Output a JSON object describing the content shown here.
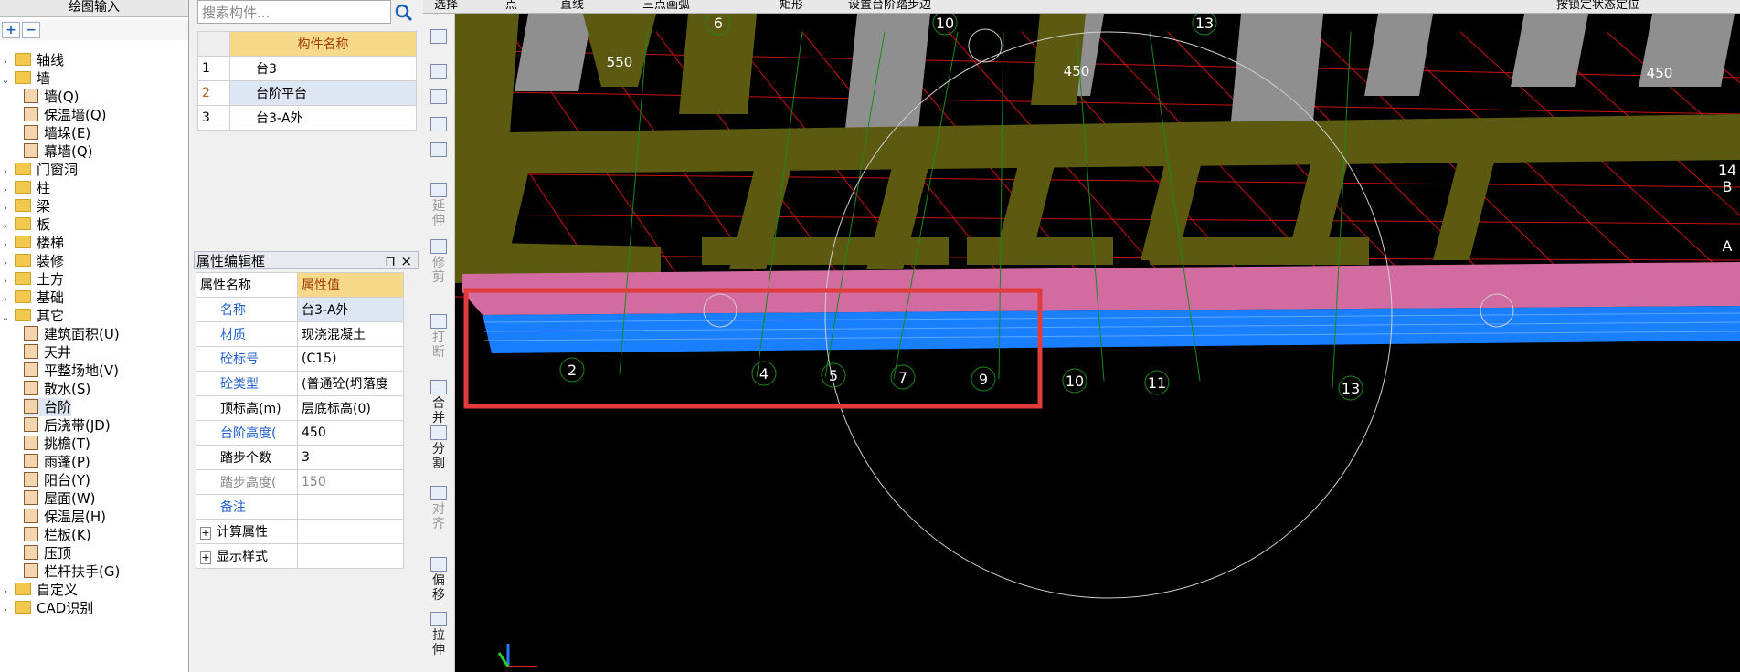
{
  "left_panel": {
    "title": "绘图输入",
    "add_label": "+",
    "remove_label": "−",
    "tree": [
      {
        "label": "轴线",
        "level": 0,
        "expander": "›"
      },
      {
        "label": "墙",
        "level": 0,
        "expander": "⌄"
      },
      {
        "label": "墙(Q)",
        "level": 1
      },
      {
        "label": "保温墙(Q)",
        "level": 1
      },
      {
        "label": "墙垛(E)",
        "level": 1
      },
      {
        "label": "幕墙(Q)",
        "level": 1
      },
      {
        "label": "门窗洞",
        "level": 0,
        "expander": "›"
      },
      {
        "label": "柱",
        "level": 0,
        "expander": "›"
      },
      {
        "label": "梁",
        "level": 0,
        "expander": "›"
      },
      {
        "label": "板",
        "level": 0,
        "expander": "›"
      },
      {
        "label": "楼梯",
        "level": 0,
        "expander": "›"
      },
      {
        "label": "装修",
        "level": 0,
        "expander": "›"
      },
      {
        "label": "土方",
        "level": 0,
        "expander": "›"
      },
      {
        "label": "基础",
        "level": 0,
        "expander": "›"
      },
      {
        "label": "其它",
        "level": 0,
        "expander": "⌄"
      },
      {
        "label": "建筑面积(U)",
        "level": 1
      },
      {
        "label": "天井",
        "level": 1
      },
      {
        "label": "平整场地(V)",
        "level": 1
      },
      {
        "label": "散水(S)",
        "level": 1
      },
      {
        "label": "台阶",
        "level": 1,
        "selected": true
      },
      {
        "label": "后浇带(JD)",
        "level": 1
      },
      {
        "label": "挑檐(T)",
        "level": 1
      },
      {
        "label": "雨蓬(P)",
        "level": 1
      },
      {
        "label": "阳台(Y)",
        "level": 1
      },
      {
        "label": "屋面(W)",
        "level": 1
      },
      {
        "label": "保温层(H)",
        "level": 1
      },
      {
        "label": "栏板(K)",
        "level": 1
      },
      {
        "label": "压顶",
        "level": 1
      },
      {
        "label": "栏杆扶手(G)",
        "level": 1
      },
      {
        "label": "自定义",
        "level": 0,
        "expander": "›"
      },
      {
        "label": "CAD识别",
        "level": 0,
        "expander": "›"
      }
    ]
  },
  "component_list": {
    "search_placeholder": "搜索构件...",
    "header": "构件名称",
    "rows": [
      {
        "index": "1",
        "name": "台3"
      },
      {
        "index": "2",
        "name": "台阶平台",
        "selected": true
      },
      {
        "index": "3",
        "name": "台3-A外"
      }
    ]
  },
  "property_panel": {
    "title": "属性编辑框",
    "pin": "⊓",
    "close": "×",
    "header_name": "属性名称",
    "header_value": "属性值",
    "rows": [
      {
        "name": "名称",
        "value": "台3-A外",
        "style": "blue"
      },
      {
        "name": "材质",
        "value": "现浇混凝土",
        "style": "blue"
      },
      {
        "name": "砼标号",
        "value": "(C15)",
        "style": "blue"
      },
      {
        "name": "砼类型",
        "value": "(普通砼(坍落度",
        "style": "blue"
      },
      {
        "name": "顶标高(m)",
        "value": "层底标高(0)",
        "style": "normal"
      },
      {
        "name": "台阶高度(",
        "value": "450",
        "style": "blue"
      },
      {
        "name": "踏步个数",
        "value": "3",
        "style": "normal"
      },
      {
        "name": "踏步高度(",
        "value": "150",
        "style": "gray"
      },
      {
        "name": "备注",
        "value": "",
        "style": "blue"
      },
      {
        "name": "计算属性",
        "value": "",
        "style": "group"
      },
      {
        "name": "显示样式",
        "value": "",
        "style": "group"
      }
    ]
  },
  "vertical_tools": [
    "延伸",
    "修剪",
    "打断",
    "合并",
    "分割",
    "对齐",
    "偏移",
    "拉伸"
  ],
  "top_toolbar": [
    "选择",
    "点",
    "直线",
    "三点画弧",
    "矩形",
    "设置台阶踏步边",
    "",
    "按锁定状态定位"
  ],
  "viewport": {
    "dimension_labels": [
      "550",
      "450",
      "450"
    ],
    "axis_top": [
      "6",
      "10",
      "13"
    ],
    "axis_bottom": [
      "2",
      "4",
      "5",
      "7",
      "9",
      "10",
      "11",
      "13"
    ],
    "axis_right": [
      "14",
      "B",
      "A"
    ],
    "colors": {
      "background": "#000000",
      "beam": "#5c5a10",
      "column": "#8f8f8f",
      "step_top": "#d26ba0",
      "step_side": "#1a7fff",
      "grid_red": "#cc1111",
      "grid_green": "#1a8a1a",
      "highlight": "#e23b3b"
    }
  }
}
